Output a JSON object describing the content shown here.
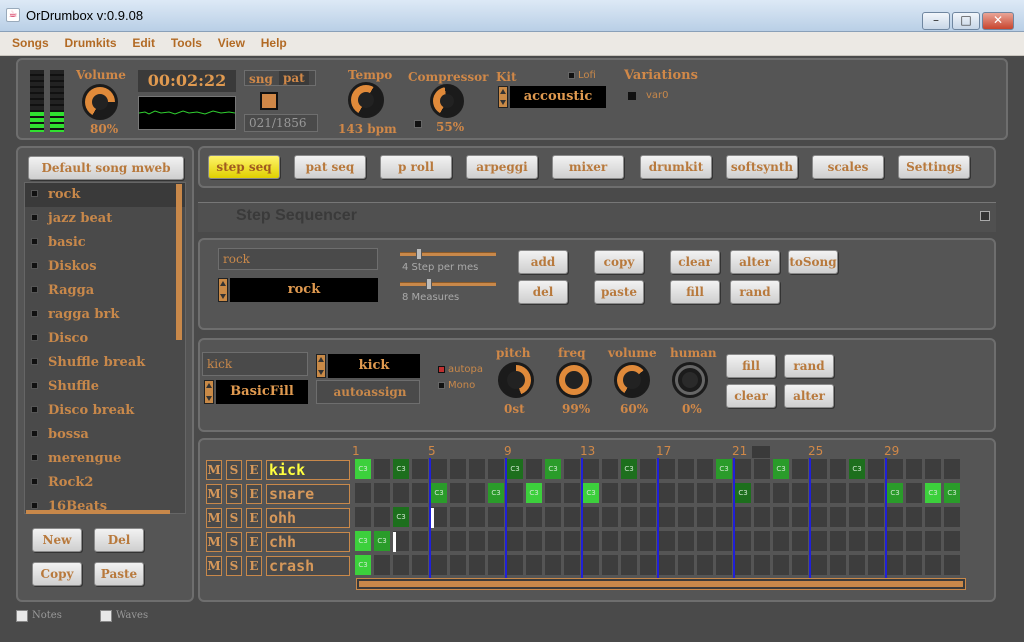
{
  "window": {
    "title": "OrDrumbox v:0.9.08"
  },
  "menu": [
    "Songs",
    "Drumkits",
    "Edit",
    "Tools",
    "View",
    "Help"
  ],
  "top": {
    "volume_label": "Volume",
    "volume_value": "80%",
    "time": "00:02:22",
    "sng_label": "sng",
    "pat_label": "pat",
    "position": "021/1856",
    "tempo_label": "Tempo",
    "tempo_value": "143 bpm",
    "compressor_label": "Compressor",
    "compressor_value": "55%",
    "kit_label": "Kit",
    "lofi_label": "Lofi",
    "kit_value": "accoustic",
    "variations_label": "Variations",
    "variation_item": "var0"
  },
  "song_panel": {
    "default_button": "Default song mweb",
    "songs": [
      "rock",
      "jazz beat",
      "basic",
      "Diskos",
      "Ragga",
      "ragga brk",
      "Disco",
      "Shuffle break",
      "Shuffle",
      "Disco break",
      "bossa",
      "merengue",
      "Rock2",
      "16Beats"
    ],
    "selected_index": 0,
    "buttons": {
      "new": "New",
      "del": "Del",
      "copy": "Copy",
      "paste": "Paste"
    }
  },
  "tabs": [
    "step seq",
    "pat seq",
    "p roll",
    "arpeggi",
    "mixer",
    "drumkit",
    "softsynth",
    "scales",
    "Settings"
  ],
  "active_tab": 0,
  "sequencer": {
    "title": "Step Sequencer",
    "pattern_name": "rock",
    "pattern_display": "rock",
    "steps_label": "4 Step per mes",
    "measures_label": "8 Measures",
    "buttons": {
      "add": "add",
      "copy": "copy",
      "clear": "clear",
      "alter": "alter",
      "tosong": "toSong",
      "del": "del",
      "paste": "paste",
      "fill": "fill",
      "rand": "rand"
    }
  },
  "instrument": {
    "name": "kick",
    "display": "kick",
    "fill_type": "BasicFill",
    "autoassign": "autoassign",
    "autopa_label": "autopa",
    "mono_label": "Mono",
    "pitch_label": "pitch",
    "pitch_value": "0st",
    "freq_label": "freq",
    "freq_value": "99%",
    "volume_label": "volume",
    "volume_value": "60%",
    "human_label": "human",
    "human_value": "0%",
    "buttons": {
      "fill": "fill",
      "rand": "rand",
      "clear": "clear",
      "alter": "alter"
    }
  },
  "grid": {
    "step_numbers": [
      "1",
      "5",
      "9",
      "13",
      "17",
      "21",
      "25",
      "29"
    ],
    "note_label": "C3",
    "mse": [
      "M",
      "S",
      "E"
    ],
    "tracks": [
      {
        "name": "kick",
        "highlight": true,
        "steps": [
          0,
          2,
          8,
          10,
          14,
          19,
          22,
          26
        ]
      },
      {
        "name": "snare",
        "highlight": false,
        "steps": [
          4,
          7,
          9,
          12,
          20,
          28,
          30,
          31
        ]
      },
      {
        "name": "ohh",
        "highlight": false,
        "steps": [
          2
        ]
      },
      {
        "name": "chh",
        "highlight": false,
        "steps": [
          0,
          1
        ]
      },
      {
        "name": "crash",
        "highlight": false,
        "steps": [
          0
        ]
      }
    ]
  },
  "footer": {
    "notes": "Notes",
    "waves": "Waves"
  },
  "colors": {
    "accent": "#c8884a",
    "active_tab": "#f0e020",
    "step_on": "#2a9c2a",
    "bar_line": "#2020d8"
  }
}
